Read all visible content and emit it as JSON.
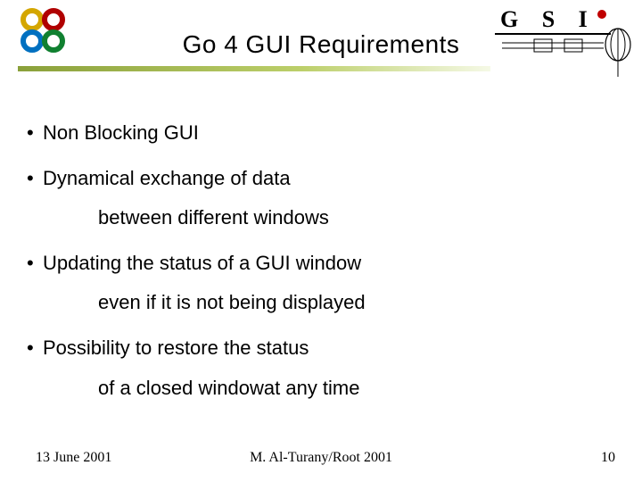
{
  "title": "Go 4 GUI Requirements",
  "bullets": [
    {
      "main": "Non Blocking GUI",
      "sub": null
    },
    {
      "main": "Dynamical exchange of data",
      "sub": "between different windows"
    },
    {
      "main": "Updating the status of a GUI window",
      "sub": "even if it is not being displayed"
    },
    {
      "main": "Possibility to restore the status",
      "sub": "of a closed windowat any time"
    }
  ],
  "footer": {
    "date": "13 June 2001",
    "author": "M. Al-Turany/Root 2001",
    "page": "10"
  },
  "icons": {
    "left_logo": "go4-rings-logo",
    "right_logo": "gsi-logo"
  }
}
